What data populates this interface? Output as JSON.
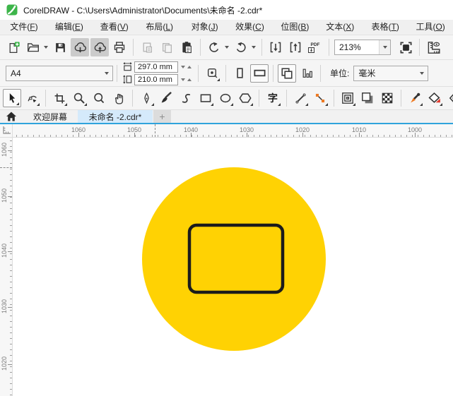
{
  "window": {
    "title": "CorelDRAW - C:\\Users\\Administrator\\Documents\\未命名 -2.cdr*"
  },
  "menu": {
    "items": [
      {
        "pre": "文件(",
        "key": "F",
        "post": ")"
      },
      {
        "pre": "编辑(",
        "key": "E",
        "post": ")"
      },
      {
        "pre": "查看(",
        "key": "V",
        "post": ")"
      },
      {
        "pre": "布局(",
        "key": "L",
        "post": ")"
      },
      {
        "pre": "对象(",
        "key": "J",
        "post": ")"
      },
      {
        "pre": "效果(",
        "key": "C",
        "post": ")"
      },
      {
        "pre": "位图(",
        "key": "B",
        "post": ")"
      },
      {
        "pre": "文本(",
        "key": "X",
        "post": ")"
      },
      {
        "pre": "表格(",
        "key": "T",
        "post": ")"
      },
      {
        "pre": "工具(",
        "key": "O",
        "post": ")"
      }
    ]
  },
  "toolbar": {
    "zoom_level": "213%",
    "pdf_label": "PDF"
  },
  "property_bar": {
    "page_size": "A4",
    "page_width": "297.0 mm",
    "page_height": "210.0 mm",
    "units_label": "单位:",
    "units_value": "毫米"
  },
  "toolbox": {
    "text_tool_glyph": "字"
  },
  "tabs": {
    "welcome": "欢迎屏幕",
    "document": "未命名 -2.cdr*",
    "new_tab": "+"
  },
  "rulers": {
    "horizontal": [
      "1060",
      "1050",
      "1040",
      "1030",
      "1020",
      "1010",
      "1000"
    ],
    "vertical": [
      "1060",
      "1050",
      "1040",
      "1030",
      "1020"
    ]
  },
  "icons": [
    "coreldraw-logo",
    "new-document",
    "open-folder",
    "save",
    "cloud-download",
    "cloud-upload",
    "print",
    "paste-special",
    "copy",
    "paste",
    "undo",
    "redo",
    "import",
    "export",
    "publish-pdf",
    "fullscreen-preview",
    "show-rulers",
    "page-width",
    "page-height",
    "autofit",
    "portrait",
    "landscape",
    "all-pages",
    "page-sorter",
    "pick-tool",
    "shape-tool",
    "crop-tool",
    "zoom-tool",
    "zoom-out-tool",
    "pan-tool",
    "pen-tool",
    "brush-tool",
    "freehand-tool",
    "rectangle-tool",
    "ellipse-tool",
    "polygon-tool",
    "text-tool",
    "line-tool",
    "connector-tool",
    "contour-tool",
    "shadow-tool",
    "transparency-tool",
    "eyedropper-tool",
    "smart-fill-tool",
    "outline-pen-tool",
    "home",
    "new-tab"
  ],
  "colors": {
    "accent_blue": "#2fa3dc",
    "tab_active": "#d5eafb",
    "shape_yellow": "#ffd203",
    "logo_green": "#3db54a"
  }
}
